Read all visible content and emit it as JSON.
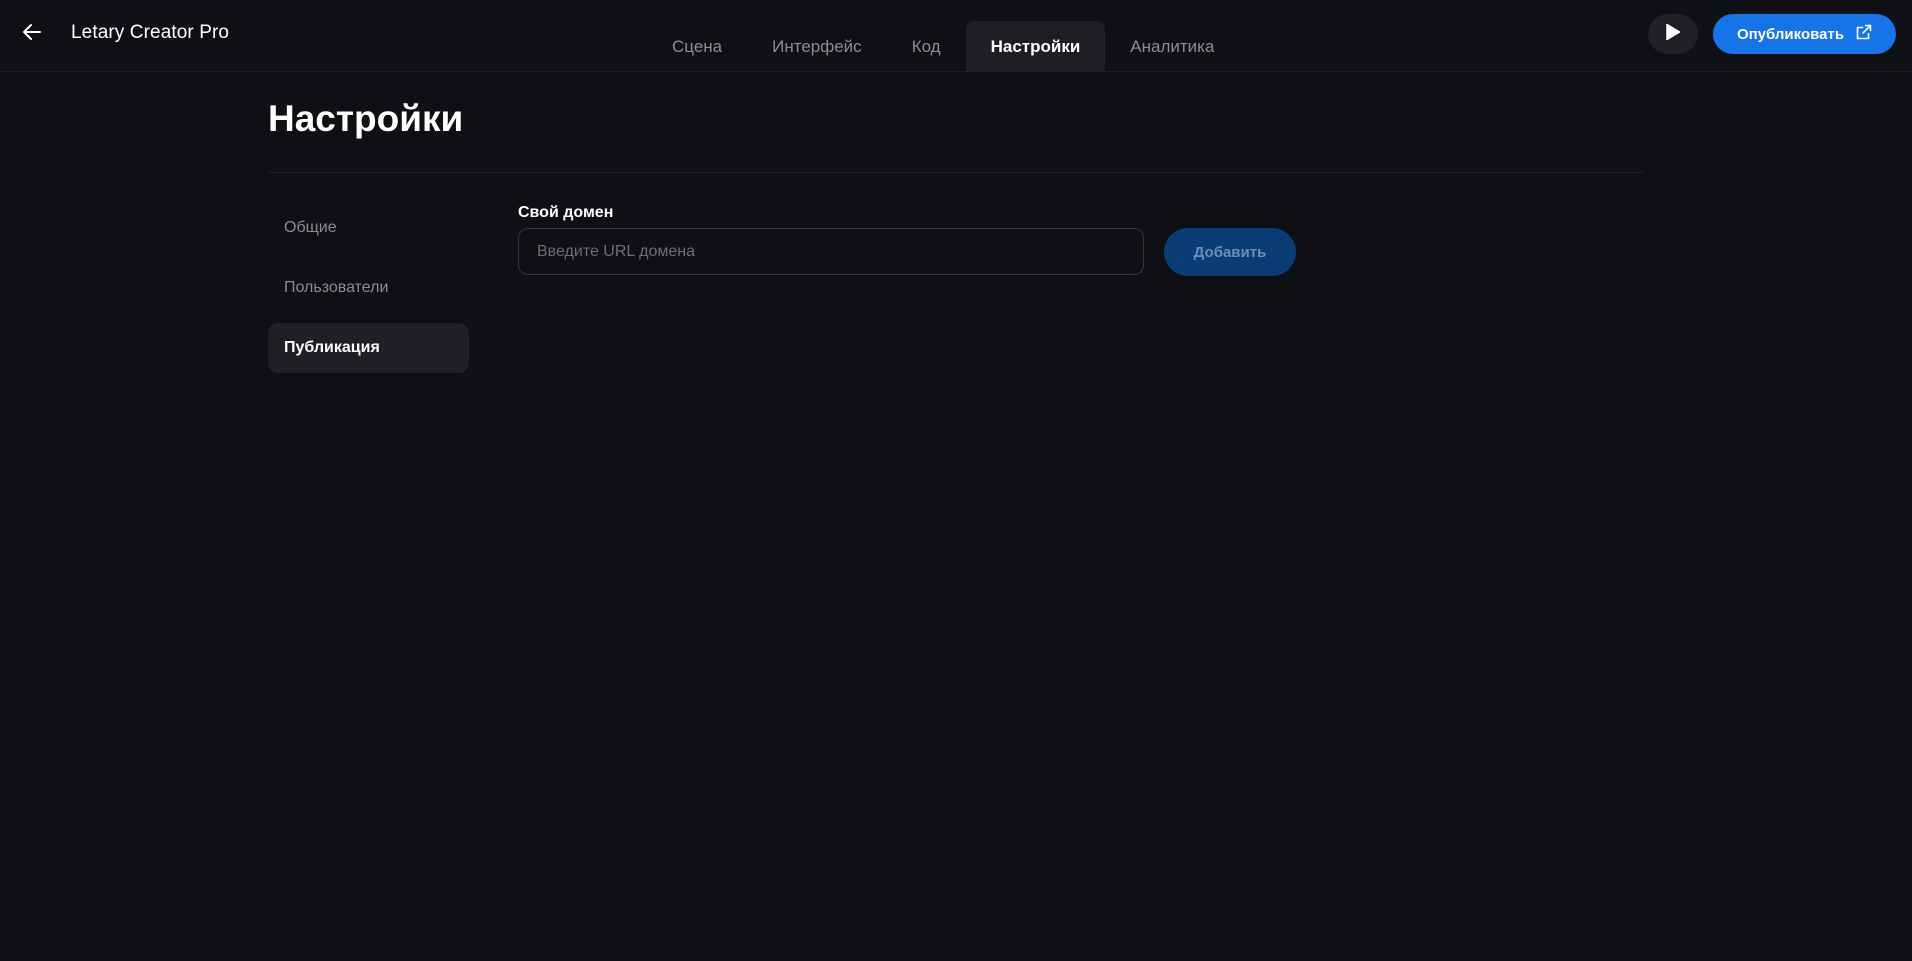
{
  "header": {
    "app_title": "Letary Creator Pro",
    "back_icon": "arrow-left-icon",
    "tabs": [
      {
        "label": "Сцена",
        "active": false
      },
      {
        "label": "Интерфейс",
        "active": false
      },
      {
        "label": "Код",
        "active": false
      },
      {
        "label": "Настройки",
        "active": true
      },
      {
        "label": "Аналитика",
        "active": false
      }
    ],
    "play_icon": "play-icon",
    "publish_label": "Опубликовать",
    "publish_icon": "external-link-icon"
  },
  "page": {
    "title": "Настройки"
  },
  "sidebar": {
    "items": [
      {
        "label": "Общие",
        "active": false
      },
      {
        "label": "Пользователи",
        "active": false
      },
      {
        "label": "Публикация",
        "active": true
      }
    ]
  },
  "domain_form": {
    "label": "Свой домен",
    "input_value": "",
    "input_placeholder": "Введите URL домена",
    "add_button_label": "Добавить"
  },
  "colors": {
    "background": "#0f1013",
    "accent": "#1474e8",
    "accent_disabled": "#0a3d75",
    "muted_text": "#8a8d93",
    "active_surface": "#1e2024"
  }
}
